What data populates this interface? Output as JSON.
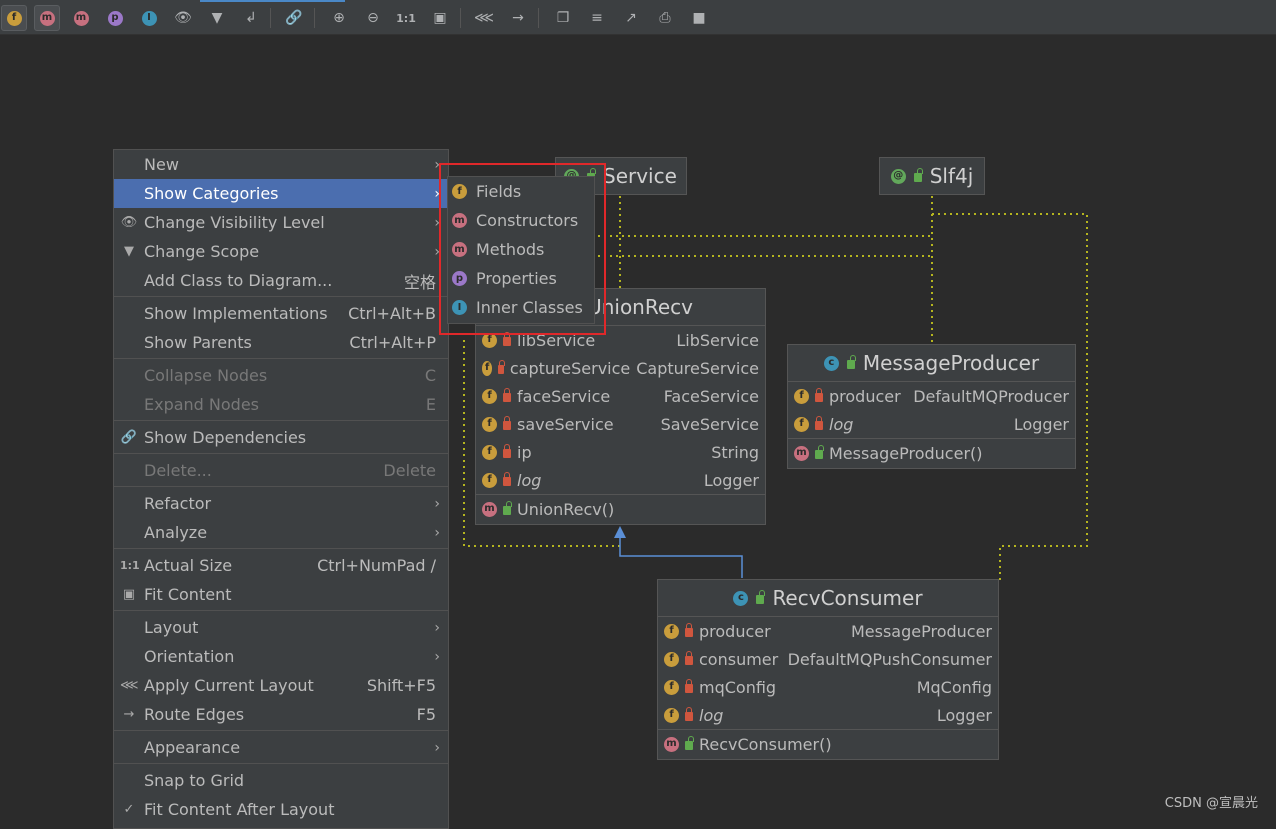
{
  "toolbar": {
    "icons": [
      "fields-icon",
      "constructors-icon",
      "methods-icon",
      "properties-icon",
      "inner-classes-icon",
      "visibility-icon",
      "filter-icon",
      "edge-icon",
      "link-icon",
      "zoom-in-icon",
      "zoom-out-icon",
      "actual-size-icon",
      "fit-content-icon",
      "layout-icon",
      "route-edges-icon",
      "copy-icon",
      "align-icon",
      "export-icon",
      "print-icon",
      "save-icon"
    ],
    "f": "f",
    "m": "m",
    "p": "p",
    "i": "I",
    "actual": "1:1"
  },
  "nodes": {
    "service": {
      "title": "Service",
      "icon": "@"
    },
    "slf4j": {
      "title": "Slf4j",
      "icon": "@"
    },
    "union": {
      "title": "UnionRecv",
      "fields": [
        {
          "name": "libService",
          "type": "LibService"
        },
        {
          "name": "captureService",
          "type": "CaptureService"
        },
        {
          "name": "faceService",
          "type": "FaceService"
        },
        {
          "name": "saveService",
          "type": "SaveService"
        },
        {
          "name": "ip",
          "type": "String"
        },
        {
          "name": "log",
          "type": "Logger"
        }
      ],
      "ctor": "UnionRecv()"
    },
    "producer": {
      "title": "MessageProducer",
      "fields": [
        {
          "name": "producer",
          "type": "DefaultMQProducer"
        },
        {
          "name": "log",
          "type": "Logger"
        }
      ],
      "ctor": "MessageProducer()"
    },
    "consumer": {
      "title": "RecvConsumer",
      "fields": [
        {
          "name": "producer",
          "type": "MessageProducer"
        },
        {
          "name": "consumer",
          "type": "DefaultMQPushConsumer"
        },
        {
          "name": "mqConfig",
          "type": "MqConfig"
        },
        {
          "name": "log",
          "type": "Logger"
        }
      ],
      "ctor": "RecvConsumer()"
    },
    "badge_f": "f",
    "badge_m": "m",
    "badge_c": "c"
  },
  "menu": {
    "items": [
      {
        "label": "New",
        "shortcut": "",
        "arrow": true
      },
      {
        "label": "Show Categories",
        "shortcut": "",
        "arrow": true
      },
      {
        "label": "Change Visibility Level",
        "shortcut": "",
        "arrow": true
      },
      {
        "label": "Change Scope",
        "shortcut": "",
        "arrow": true
      },
      {
        "label": "Add Class to Diagram...",
        "shortcut": "空格"
      },
      {
        "label": "Show Implementations",
        "shortcut": "Ctrl+Alt+B"
      },
      {
        "label": "Show Parents",
        "shortcut": "Ctrl+Alt+P"
      },
      {
        "label": "Collapse Nodes",
        "shortcut": "C"
      },
      {
        "label": "Expand Nodes",
        "shortcut": "E"
      },
      {
        "label": "Show Dependencies",
        "shortcut": ""
      },
      {
        "label": "Delete...",
        "shortcut": "Delete"
      },
      {
        "label": "Refactor",
        "shortcut": "",
        "arrow": true
      },
      {
        "label": "Analyze",
        "shortcut": "",
        "arrow": true
      },
      {
        "label": "Actual Size",
        "shortcut": "Ctrl+NumPad /"
      },
      {
        "label": "Fit Content",
        "shortcut": ""
      },
      {
        "label": "Layout",
        "shortcut": "",
        "arrow": true
      },
      {
        "label": "Orientation",
        "shortcut": "",
        "arrow": true
      },
      {
        "label": "Apply Current Layout",
        "shortcut": "Shift+F5"
      },
      {
        "label": "Route Edges",
        "shortcut": "F5"
      },
      {
        "label": "Appearance",
        "shortcut": "",
        "arrow": true
      },
      {
        "label": "Snap to Grid",
        "shortcut": ""
      },
      {
        "label": "Fit Content After Layout",
        "shortcut": ""
      }
    ],
    "actual_icon": "1:1",
    "arrow": "›",
    "check": "✓"
  },
  "submenu": {
    "items": [
      {
        "label": "Fields",
        "badge": "f"
      },
      {
        "label": "Constructors",
        "badge": "m"
      },
      {
        "label": "Methods",
        "badge": "m"
      },
      {
        "label": "Properties",
        "badge": "p"
      },
      {
        "label": "Inner Classes",
        "badge": "I"
      }
    ]
  },
  "watermark": "CSDN @宣晨光",
  "colors": {
    "accent": "#4b6eaf",
    "highlight": "#e0282a",
    "background": "#2b2b2b"
  }
}
